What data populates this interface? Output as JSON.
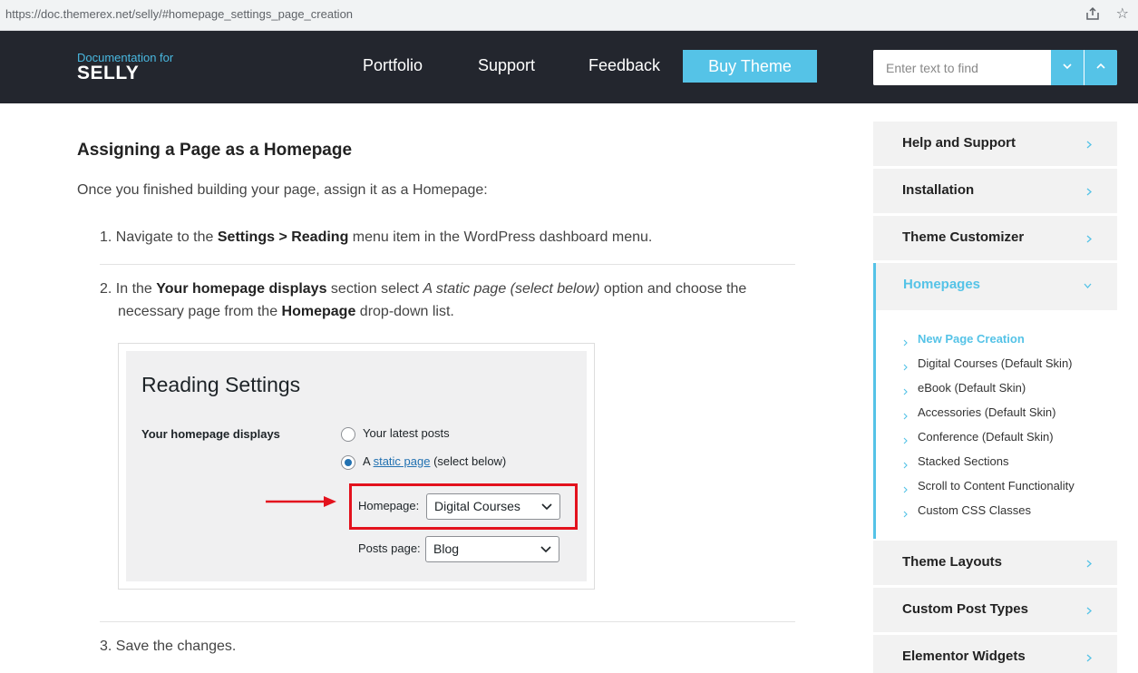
{
  "browser": {
    "url": "https://doc.themerex.net/selly/#homepage_settings_page_creation"
  },
  "header": {
    "logo_small": "Documentation for",
    "logo_big": "SELLY",
    "nav": [
      "Portfolio",
      "Support",
      "Feedback"
    ],
    "buy_label": "Buy Theme",
    "search_placeholder": "Enter text to find"
  },
  "content": {
    "heading": "Assigning a Page as a Homepage",
    "intro": "Once you finished building your page, assign it as a Homepage:",
    "step1": {
      "num": "1.",
      "pre": "Navigate to the ",
      "b1": "Settings > Reading",
      "post": " menu item in the WordPress dashboard menu."
    },
    "step2": {
      "num": "2.",
      "pre": "In the ",
      "b1": "Your homepage displays",
      "mid": " section select ",
      "i1": "A static page (select below)",
      "mid2": " option and choose the necessary page from the ",
      "b2": "Homepage",
      "post": " drop-down list."
    },
    "step3": {
      "num": "3.",
      "text": "Save the changes."
    }
  },
  "figure": {
    "title": "Reading Settings",
    "label": "Your homepage displays",
    "option1": "Your latest posts",
    "option2_pre": "A ",
    "option2_link": "static page",
    "option2_post": " (select below)",
    "homepage_label": "Homepage:",
    "homepage_value": "Digital Courses",
    "posts_label": "Posts page:",
    "posts_value": "Blog"
  },
  "sidebar": {
    "items_top": [
      "Help and Support",
      "Installation",
      "Theme Customizer"
    ],
    "active": "Homepages",
    "subitems": [
      "New Page Creation",
      "Digital Courses (Default Skin)",
      "eBook (Default Skin)",
      "Accessories (Default Skin)",
      "Conference (Default Skin)",
      "Stacked Sections",
      "Scroll to Content Functionality",
      "Custom CSS Classes"
    ],
    "items_bottom": [
      "Theme Layouts",
      "Custom Post Types",
      "Elementor Widgets"
    ]
  },
  "colors": {
    "accent": "#55c3e7",
    "header_bg": "#23262e",
    "highlight": "#e3121d"
  }
}
